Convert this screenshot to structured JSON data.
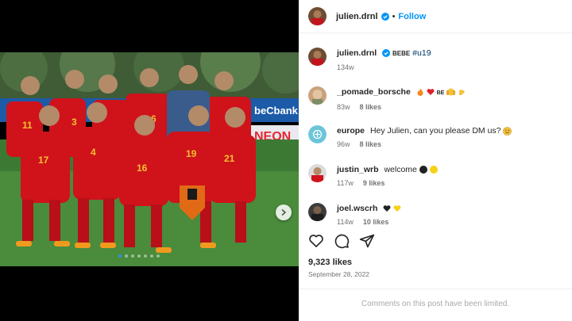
{
  "post": {
    "author": "julien.drnl",
    "follow_label": "Follow",
    "separator": "•",
    "caption_tag": "BEBE",
    "caption_hashtag": "#u19",
    "caption_age": "134w",
    "likes": "9,323 likes",
    "date": "September 28, 2022",
    "comments_limited": "Comments on this post have been limited."
  },
  "media": {
    "slide_count": 7,
    "active_slide": 1,
    "banner_text": "beCbank",
    "ad_text": "NEON",
    "shirt_numbers": [
      "11",
      "3",
      "6",
      "17",
      "4",
      "16",
      "19",
      "21"
    ]
  },
  "comments": [
    {
      "username": "_pomade_borsche",
      "text": "",
      "emoji": [
        "fire-emoji",
        "red-heart-emoji"
      ],
      "tag": "BE",
      "emoji_after": [
        "face-with-hands-emoji",
        "flexed-biceps-emoji"
      ],
      "age": "83w",
      "likes": "8 likes"
    },
    {
      "username": "europe",
      "text": "Hey Julien, can you please DM us?",
      "emoji": [
        "smiling-face-emoji"
      ],
      "age": "96w",
      "likes": "8 likes"
    },
    {
      "username": "justin_wrb",
      "text": "welcome",
      "emoji": [
        "black-circle-emoji",
        "yellow-circle-emoji"
      ],
      "age": "117w",
      "likes": "9 likes"
    },
    {
      "username": "joel.wscrh",
      "text": "",
      "emoji": [
        "black-heart-emoji",
        "yellow-heart-emoji"
      ],
      "age": "114w",
      "likes": "10 likes"
    }
  ],
  "colors": {
    "accent": "#0095f6",
    "verified": "#0095f6",
    "jersey_red": "#d0121b",
    "pitch_green": "#3c7a33"
  }
}
